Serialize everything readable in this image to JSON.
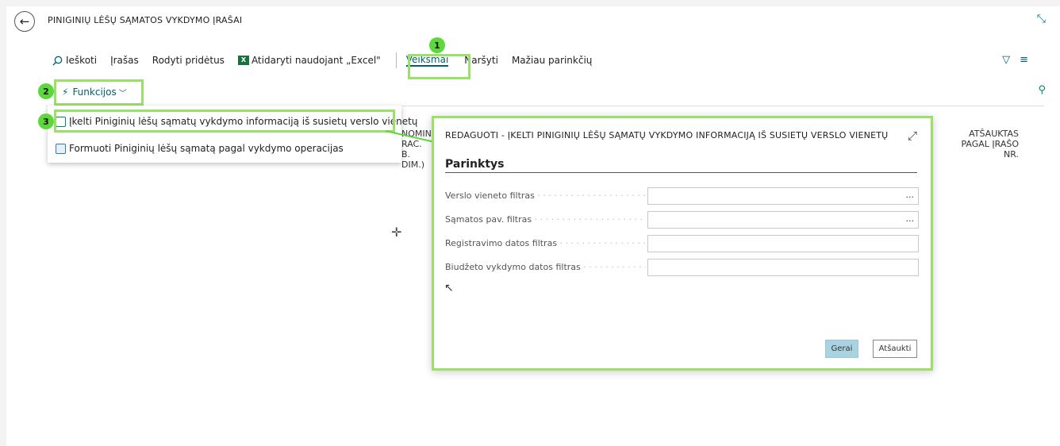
{
  "header": {
    "title": "PINIGINIŲ LĖŠŲ SĄMATOS VYKDYMO ĮRAŠAI",
    "back_icon": "arrow-left-icon",
    "collapse_icon": "collapse-icon"
  },
  "toolbar": {
    "search_label": "Ieškoti",
    "record_label": "Įrašas",
    "show_attached_label": "Rodyti pridėtus",
    "excel_label": "Atidaryti naudojant „Excel\"",
    "excel_icon_text": "X",
    "actions_label": "Veiksmai",
    "navigate_label": "Naršyti",
    "fewer_options_label": "Mažiau parinkčių"
  },
  "functions": {
    "label": "Funkcijos"
  },
  "menu": {
    "items": [
      {
        "label": "Įkelti Piniginių lėšų sąmatų vykdymo informaciją iš susietų verslo vienetų"
      },
      {
        "label": "Formuoti Piniginių lėšų sąmatą pagal vykdymo operacijas"
      }
    ]
  },
  "annotations": {
    "badge1": "1",
    "badge2": "2",
    "badge3": "3",
    "accent": "#9be06a",
    "badge_color": "#5dd83a"
  },
  "columns": {
    "partial_col_lines": [
      "NOMIN",
      "RAC.",
      "B. DIM.)"
    ],
    "right_col_lines": [
      "ATŠAUKTAS",
      "PAGAL ĮRAŠO",
      "NR."
    ]
  },
  "dialog": {
    "title": "REDAGUOTI - ĮKELTI PINIGINIŲ LĖŠŲ SĄMATŲ VYKDYMO INFORMACIJĄ IŠ SUSIETŲ VERSLO VIENETŲ",
    "section": "Parinktys",
    "fields": [
      {
        "label": "Verslo vieneto filtras",
        "value": "",
        "has_lookup": true
      },
      {
        "label": "Sąmatos pav. filtras",
        "value": "",
        "has_lookup": true
      },
      {
        "label": "Registravimo datos filtras",
        "value": "",
        "has_lookup": false
      },
      {
        "label": "Biudžeto vykdymo datos filtras",
        "value": "",
        "has_lookup": false
      }
    ],
    "lookup_text": "...",
    "ok_label": "Gerai",
    "cancel_label": "Atšaukti"
  }
}
